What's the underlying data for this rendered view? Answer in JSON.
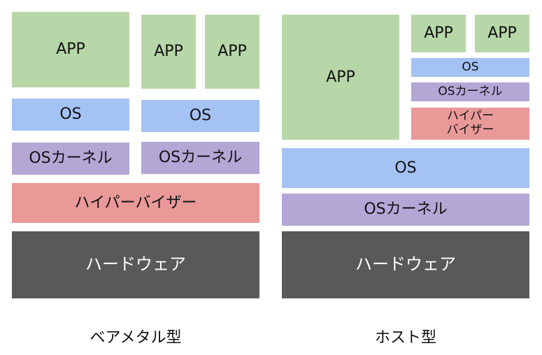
{
  "bare_metal": {
    "caption": "ベアメタル型",
    "app_large": "APP",
    "app_mid": "APP",
    "app_right": "APP",
    "os_left": "OS",
    "os_right": "OS",
    "kernel_left": "OSカーネル",
    "kernel_right": "OSカーネル",
    "hypervisor": "ハイパーバイザー",
    "hardware": "ハードウェア"
  },
  "hosted": {
    "caption": "ホスト型",
    "app_large": "APP",
    "app_small_left": "APP",
    "app_small_right": "APP",
    "guest_os": "OS",
    "guest_kernel": "OSカーネル",
    "hypervisor": "ハイパー\nバイザー",
    "host_os": "OS",
    "host_kernel": "OSカーネル",
    "hardware": "ハードウェア"
  },
  "colors": {
    "app": "#b7d7a8",
    "os": "#a4c2f4",
    "kernel": "#b4a7d6",
    "hypervisor": "#ea9999",
    "hardware": "#595959"
  }
}
